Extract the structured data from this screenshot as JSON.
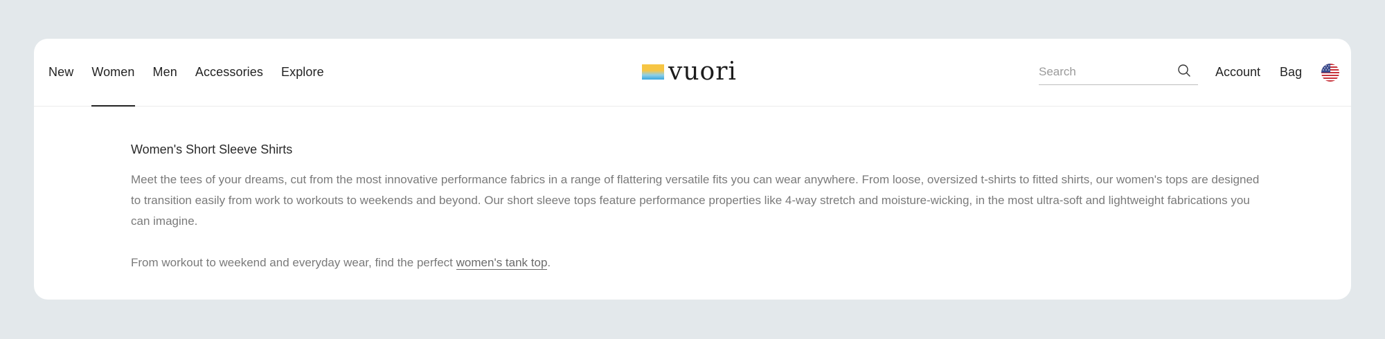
{
  "header": {
    "nav": [
      {
        "label": "New"
      },
      {
        "label": "Women",
        "active": true
      },
      {
        "label": "Men"
      },
      {
        "label": "Accessories"
      },
      {
        "label": "Explore"
      }
    ],
    "logo_text": "vuori",
    "search": {
      "placeholder": "Search",
      "value": ""
    },
    "account_label": "Account",
    "bag_label": "Bag",
    "region_flag": "us-flag-icon"
  },
  "content": {
    "title": "Women's Short Sleeve Shirts",
    "description": "Meet the tees of your dreams, cut from the most innovative performance fabrics in a range of flattering versatile fits you can wear anywhere. From loose, oversized t-shirts to fitted shirts, our women's tops are designed to transition easily from work to workouts to weekends and beyond. Our short sleeve tops feature performance properties like 4-way stretch and moisture-wicking, in the most ultra-soft and lightweight fabrications you can imagine.",
    "cta_prefix": "From workout to weekend and everyday wear, find the perfect ",
    "cta_link": "women's tank top",
    "cta_suffix": "."
  },
  "colors": {
    "page_background": "#e3e8eb",
    "card_background": "#ffffff",
    "text_primary": "#232323",
    "text_secondary": "#7a7a7a"
  }
}
